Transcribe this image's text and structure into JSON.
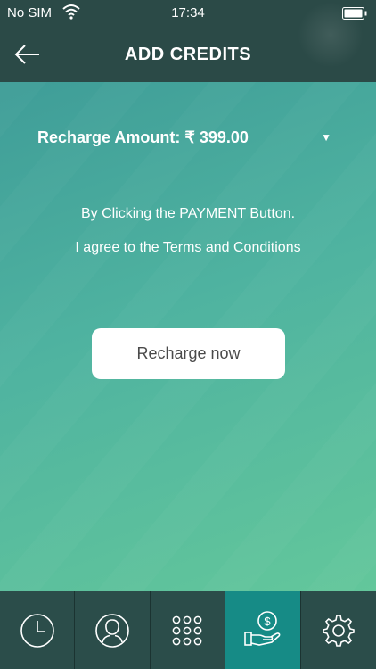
{
  "status_bar": {
    "carrier": "No SIM",
    "time": "17:34"
  },
  "nav": {
    "title": "ADD CREDITS"
  },
  "recharge": {
    "label": "Recharge Amount:",
    "amount": "₹ 399.00"
  },
  "terms": {
    "line1": "By Clicking the PAYMENT Button.",
    "line2": "I agree to the Terms and Conditions"
  },
  "button": {
    "label": "Recharge now"
  },
  "tabs": [
    {
      "icon": "clock-icon"
    },
    {
      "icon": "user-icon"
    },
    {
      "icon": "keypad-icon"
    },
    {
      "icon": "payment-icon",
      "active": true
    },
    {
      "icon": "gear-icon"
    }
  ],
  "colors": {
    "bar": "#2b4a47",
    "gradient_start": "#3f9d98",
    "gradient_end": "#63c79b",
    "active_tab": "#168b86"
  }
}
